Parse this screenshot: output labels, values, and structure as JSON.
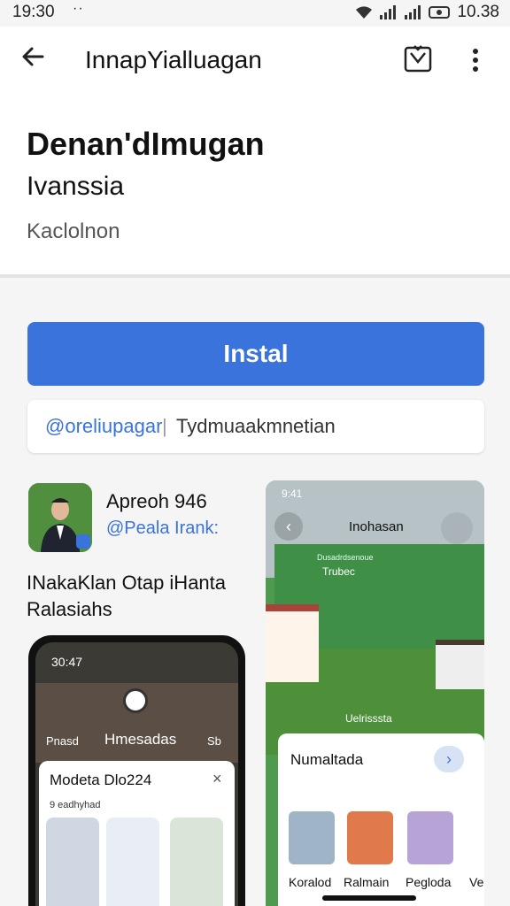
{
  "status_bar": {
    "time": "19:30",
    "dots": "··",
    "right_text": "10.38"
  },
  "toolbar": {
    "title": "InnapYialluagan"
  },
  "app": {
    "title": "Denan'dImugan",
    "subtitle": "Ivanssia",
    "developer": "Kaclolnon",
    "install_label": "Instal",
    "tag_primary": "@oreliupagar",
    "tag_separator": "|",
    "tag_secondary": "Tydmuaakmnetian"
  },
  "developer_card": {
    "name": "Apreoh 946",
    "handle": "@Peala Irank:",
    "description": "INakaKlan Otap iHanta Ralasiahs"
  },
  "screenshot_left": {
    "time": "30:47",
    "label_left": "Pnasd",
    "label_mid": "Hmesadas",
    "label_right": "Sb",
    "sheet_title": "Modeta Dlo224",
    "sheet_close": "×",
    "sheet_sub": "9 eadhyhad"
  },
  "screenshot_right": {
    "time": "9:41",
    "title": "Inohasan",
    "green_label": "Dusadrdsenoue",
    "green_item": "Trubec",
    "road_label": "Uelrisssta",
    "sheet_title": "Numaltada",
    "thumbs": [
      "Koralod",
      "Ralmain",
      "Pegloda"
    ],
    "thumb_more": "Ve"
  },
  "colors": {
    "accent": "#3a73db",
    "green": "#4e9a4e"
  }
}
